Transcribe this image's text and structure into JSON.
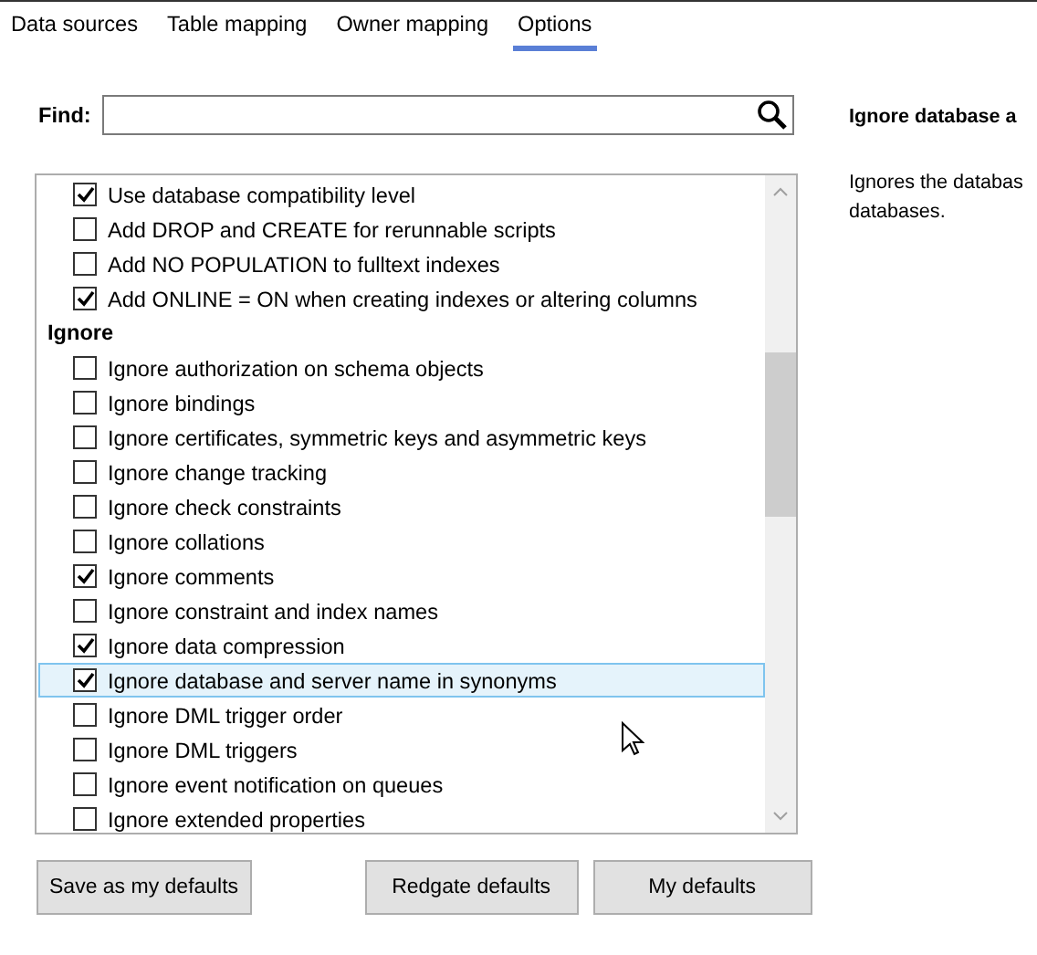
{
  "tabs": [
    {
      "label": "Data sources",
      "selected": false
    },
    {
      "label": "Table mapping",
      "selected": false
    },
    {
      "label": "Owner mapping",
      "selected": false
    },
    {
      "label": "Options",
      "selected": true
    }
  ],
  "find": {
    "label": "Find:"
  },
  "options": [
    {
      "kind": "option",
      "label": "Use database compatibility level",
      "checked": true,
      "selected": false
    },
    {
      "kind": "option",
      "label": "Add DROP and CREATE for rerunnable scripts",
      "checked": false,
      "selected": false
    },
    {
      "kind": "option",
      "label": "Add NO POPULATION to fulltext indexes",
      "checked": false,
      "selected": false
    },
    {
      "kind": "option",
      "label": "Add ONLINE = ON when creating indexes or altering columns",
      "checked": true,
      "selected": false
    },
    {
      "kind": "header",
      "label": "Ignore"
    },
    {
      "kind": "option",
      "label": "Ignore authorization on schema objects",
      "checked": false,
      "selected": false
    },
    {
      "kind": "option",
      "label": "Ignore bindings",
      "checked": false,
      "selected": false
    },
    {
      "kind": "option",
      "label": "Ignore certificates, symmetric keys and asymmetric keys",
      "checked": false,
      "selected": false
    },
    {
      "kind": "option",
      "label": "Ignore change tracking",
      "checked": false,
      "selected": false
    },
    {
      "kind": "option",
      "label": "Ignore check constraints",
      "checked": false,
      "selected": false
    },
    {
      "kind": "option",
      "label": "Ignore collations",
      "checked": false,
      "selected": false
    },
    {
      "kind": "option",
      "label": "Ignore comments",
      "checked": true,
      "selected": false
    },
    {
      "kind": "option",
      "label": "Ignore constraint and index names",
      "checked": false,
      "selected": false
    },
    {
      "kind": "option",
      "label": "Ignore data compression",
      "checked": true,
      "selected": false
    },
    {
      "kind": "option",
      "label": "Ignore database and server name in synonyms",
      "checked": true,
      "selected": true
    },
    {
      "kind": "option",
      "label": "Ignore DML trigger order",
      "checked": false,
      "selected": false
    },
    {
      "kind": "option",
      "label": "Ignore DML triggers",
      "checked": false,
      "selected": false
    },
    {
      "kind": "option",
      "label": "Ignore event notification on queues",
      "checked": false,
      "selected": false
    },
    {
      "kind": "option",
      "label": "Ignore extended properties",
      "checked": false,
      "selected": false
    }
  ],
  "details": {
    "title": "Ignore database a",
    "description_lines": [
      "Ignores the databas",
      "databases."
    ]
  },
  "buttons": [
    "Save as my defaults",
    "Redgate defaults",
    "My defaults"
  ]
}
